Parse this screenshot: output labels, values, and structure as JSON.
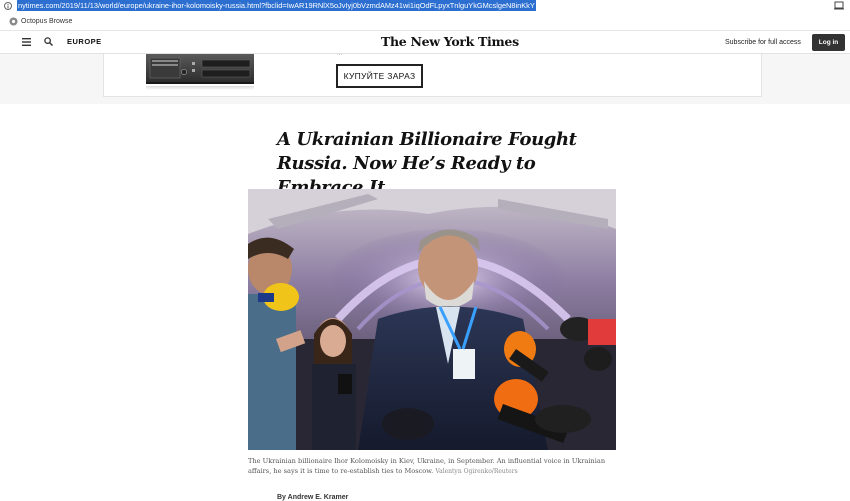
{
  "browser": {
    "url": "nytimes.com/2019/11/13/world/europe/ukraine-ihor-kolomoisky-russia.html?fbclid=IwAR19RNlX5oJvIyj0bVzmdAMz41wi1iqOdFLpyxTnlguYkGMcslgeN8inKkY",
    "bookmark_label": "Octopus Browse"
  },
  "header": {
    "section": "EUROPE",
    "logo": "The New York Times",
    "subscribe": "Subscribe for full access",
    "login": "Log in"
  },
  "ad": {
    "button_label": "КУПУЙТЕ ЗАРАЗ",
    "fragment": "..."
  },
  "article": {
    "headline": "A Ukrainian Billionaire Fought Russia. Now He’s Ready to Embrace It.",
    "caption": "The Ukrainian billionaire Ihor Kolomoisky in Kiev, Ukraine, in September. An influential voice in Ukrainian affairs, he says it is time to re-establish ties to Moscow.",
    "credit": "Valentyn Ogirenko/Reuters",
    "byline": "By Andrew E. Kramer"
  },
  "colors": {
    "url_highlight": "#2c6fd1",
    "login_bg": "#333333",
    "ad_band": "#f6f6f6"
  }
}
